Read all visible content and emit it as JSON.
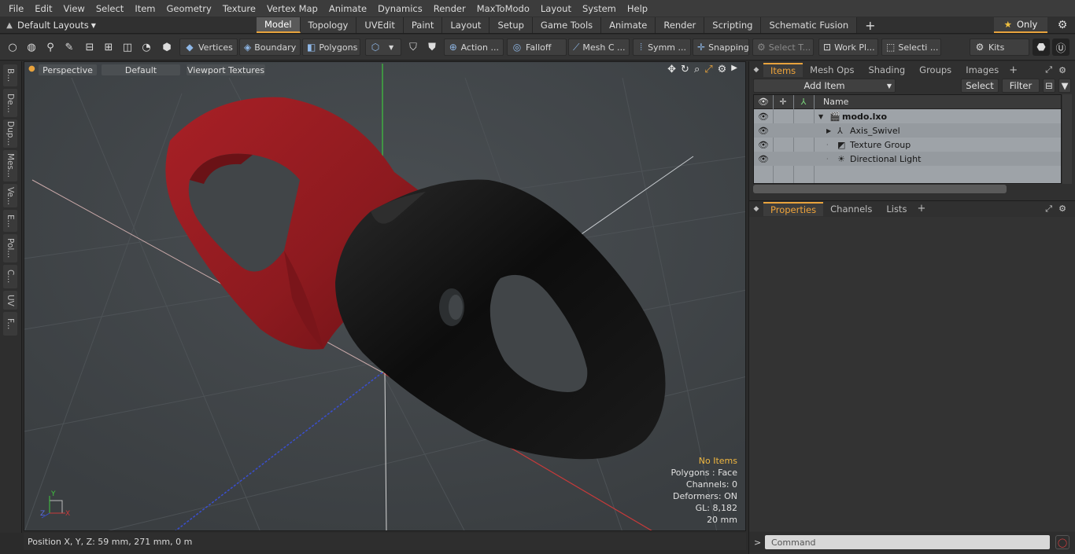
{
  "menu": [
    "File",
    "Edit",
    "View",
    "Select",
    "Item",
    "Geometry",
    "Texture",
    "Vertex Map",
    "Animate",
    "Dynamics",
    "Render",
    "MaxToModo",
    "Layout",
    "System",
    "Help"
  ],
  "layout_selector": "Default Layouts",
  "layout_tabs": [
    "Model",
    "Topology",
    "UVEdit",
    "Paint",
    "Layout",
    "Setup",
    "Game Tools",
    "Animate",
    "Render",
    "Scripting",
    "Schematic Fusion"
  ],
  "active_layout_tab": "Model",
  "only_label": "Only",
  "toolbar": {
    "vertices": "Vertices",
    "boundary": "Boundary",
    "polygons": "Polygons",
    "action": "Action ...",
    "falloff": "Falloff",
    "mesh": "Mesh C ...",
    "symm": "Symm ...",
    "snapping": "Snapping",
    "select_t": "Select T...",
    "work_pl": "Work Pl...",
    "selecti": "Selecti ...",
    "kits": "Kits"
  },
  "left_tabs": [
    "B...",
    "De...",
    "Dup...",
    "Mes...",
    "Ve...",
    "E...",
    "Pol...",
    "C...",
    "UV",
    "F..."
  ],
  "viewport": {
    "view_mode": "Perspective",
    "shading": "Default",
    "textures": "Viewport Textures",
    "hud": [
      "No Items",
      "Polygons : Face",
      "Channels: 0",
      "Deformers: ON",
      "GL: 8,182",
      "20 mm"
    ],
    "axis_labels": {
      "x": "X",
      "y": "Y",
      "z": "Z"
    },
    "object_colors": {
      "red": "#9c1d22",
      "black": "#121212"
    }
  },
  "status": "Position X, Y, Z:   59 mm, 271 mm, 0 m",
  "items_panel": {
    "tabs": [
      "Items",
      "Mesh Ops",
      "Shading",
      "Groups",
      "Images"
    ],
    "active_tab": "Items",
    "add_item": "Add Item",
    "select": "Select",
    "filter": "Filter",
    "name_header": "Name",
    "rows": [
      {
        "label": "modo.lxo",
        "depth": 0,
        "icon": "scene-icon",
        "bold": true,
        "expand": "expanded"
      },
      {
        "label": "Axis_Swivel",
        "depth": 1,
        "icon": "mesh-icon",
        "bold": false,
        "expand": "collapsed"
      },
      {
        "label": "Texture Group",
        "depth": 1,
        "icon": "texture-group-icon",
        "bold": false,
        "expand": "none"
      },
      {
        "label": "Directional Light",
        "depth": 1,
        "icon": "light-icon",
        "bold": false,
        "expand": "none"
      }
    ]
  },
  "properties_panel": {
    "tabs": [
      "Properties",
      "Channels",
      "Lists"
    ],
    "active_tab": "Properties"
  },
  "command_placeholder": "Command",
  "colors": {
    "accent": "#e8a33d",
    "hud_highlight": "#f0b740"
  }
}
